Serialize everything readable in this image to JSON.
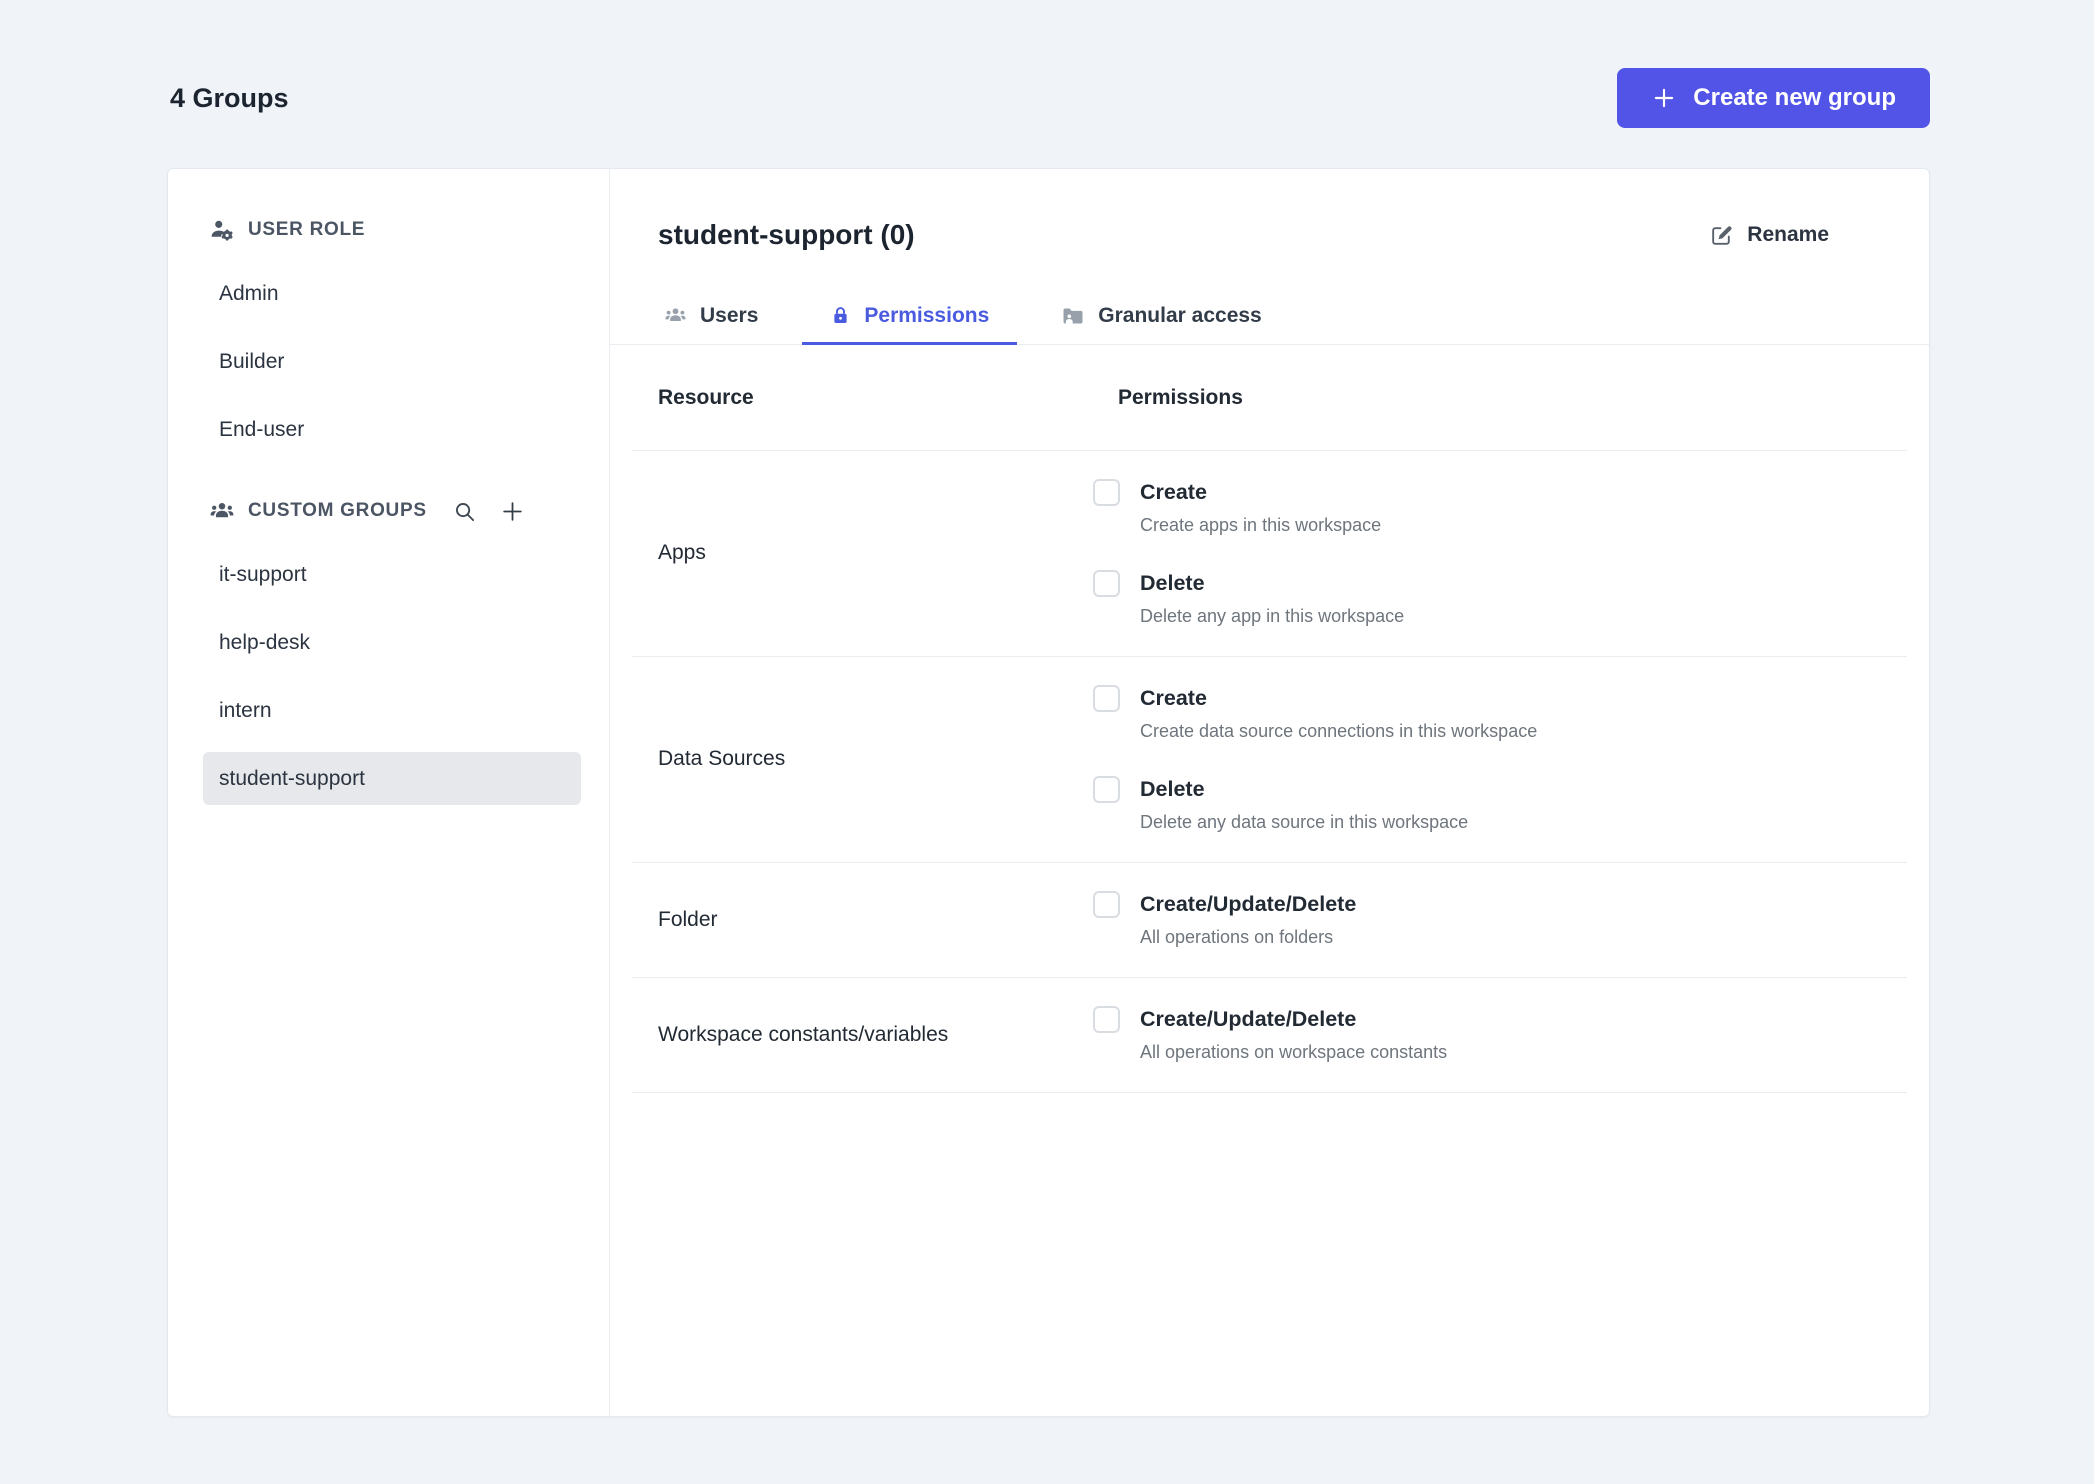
{
  "page": {
    "title": "4 Groups",
    "create_button_label": "Create new group"
  },
  "colors": {
    "button_bg": "#5254e8",
    "active_tab": "#4a5be0",
    "page_bg": "#f0f4f9",
    "selected_item_bg": "#e6e8eb"
  },
  "icons": {
    "user_role": "person-gear",
    "custom_groups": "people",
    "search": "magnifier",
    "add_group": "plus",
    "rename": "pencil-square",
    "users_tab": "people",
    "permissions_tab": "lock",
    "granular_tab": "folder-user",
    "create_button": "plus"
  },
  "sidebar": {
    "user_role_header": "USER ROLE",
    "user_roles": [
      "Admin",
      "Builder",
      "End-user"
    ],
    "custom_groups_header": "CUSTOM GROUPS",
    "custom_groups": [
      "it-support",
      "help-desk",
      "intern",
      "student-support"
    ],
    "selected_group": "student-support"
  },
  "panel": {
    "title": "student-support (0)",
    "rename_label": "Rename",
    "tabs": [
      {
        "label": "Users",
        "active": false
      },
      {
        "label": "Permissions",
        "active": true
      },
      {
        "label": "Granular access",
        "active": false
      }
    ],
    "table": {
      "resource_header": "Resource",
      "permissions_header": "Permissions",
      "rows": [
        {
          "resource": "Apps",
          "items": [
            {
              "label": "Create",
              "description": "Create apps in this workspace",
              "checked": false
            },
            {
              "label": "Delete",
              "description": "Delete any app in this workspace",
              "checked": false
            }
          ]
        },
        {
          "resource": "Data Sources",
          "items": [
            {
              "label": "Create",
              "description": "Create data source connections in this workspace",
              "checked": false
            },
            {
              "label": "Delete",
              "description": "Delete any data source in this workspace",
              "checked": false
            }
          ]
        },
        {
          "resource": "Folder",
          "items": [
            {
              "label": "Create/Update/Delete",
              "description": "All operations on folders",
              "checked": false
            }
          ]
        },
        {
          "resource": "Workspace constants/variables",
          "items": [
            {
              "label": "Create/Update/Delete",
              "description": "All operations on workspace constants",
              "checked": false
            }
          ]
        }
      ]
    }
  }
}
